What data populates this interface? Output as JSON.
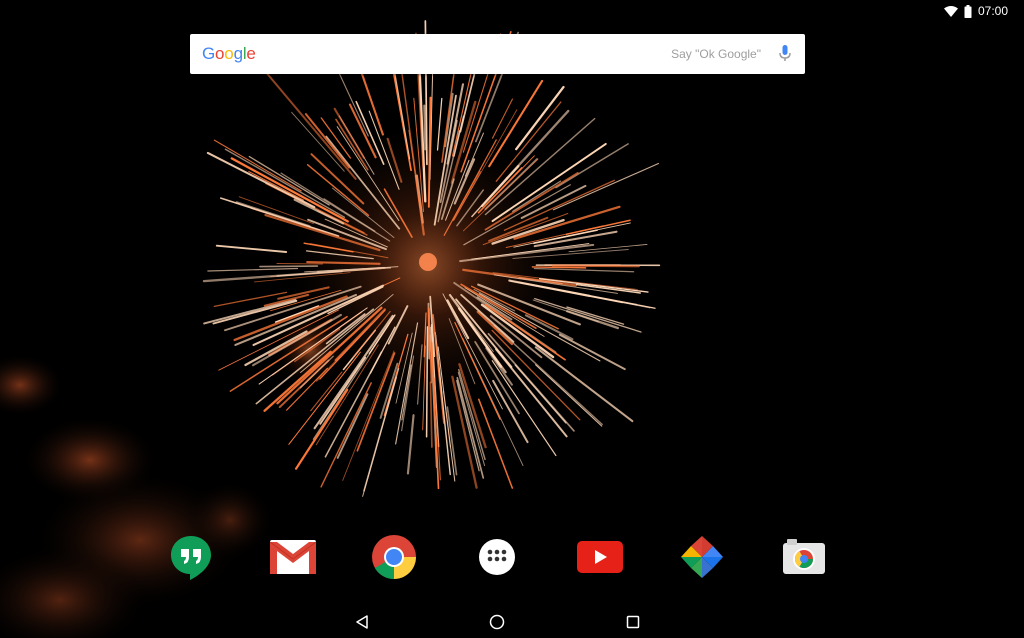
{
  "status_bar": {
    "time": "07:00",
    "icons": [
      "wifi-icon",
      "battery-icon"
    ]
  },
  "search": {
    "logo_letters": [
      {
        "char": "G",
        "color": "#4285F4"
      },
      {
        "char": "o",
        "color": "#EA4335"
      },
      {
        "char": "o",
        "color": "#FBBC05"
      },
      {
        "char": "g",
        "color": "#4285F4"
      },
      {
        "char": "l",
        "color": "#34A853"
      },
      {
        "char": "e",
        "color": "#EA4335"
      }
    ],
    "hint": "Say \"Ok Google\"",
    "mic_icon": "mic-icon"
  },
  "dock": {
    "apps": [
      {
        "name": "Hangouts",
        "icon": "hangouts-icon",
        "color": "#0F9D58"
      },
      {
        "name": "Gmail",
        "icon": "gmail-icon",
        "color": "#DB4437"
      },
      {
        "name": "Chrome",
        "icon": "chrome-icon",
        "color": "#4285F4"
      },
      {
        "name": "Apps",
        "icon": "app-drawer-icon",
        "color": "#ffffff"
      },
      {
        "name": "YouTube",
        "icon": "youtube-icon",
        "color": "#E62117"
      },
      {
        "name": "Photos",
        "icon": "photos-pinwheel-icon",
        "color": "#F4B400"
      },
      {
        "name": "Camera",
        "icon": "camera-icon",
        "color": "#9e9e9e"
      }
    ]
  },
  "nav": {
    "buttons": [
      "back-icon",
      "home-icon",
      "recents-icon"
    ]
  },
  "wallpaper": {
    "subject": "fireworks",
    "spark_color": "#ffd8b8",
    "glow_color": "#ff7a3a"
  }
}
